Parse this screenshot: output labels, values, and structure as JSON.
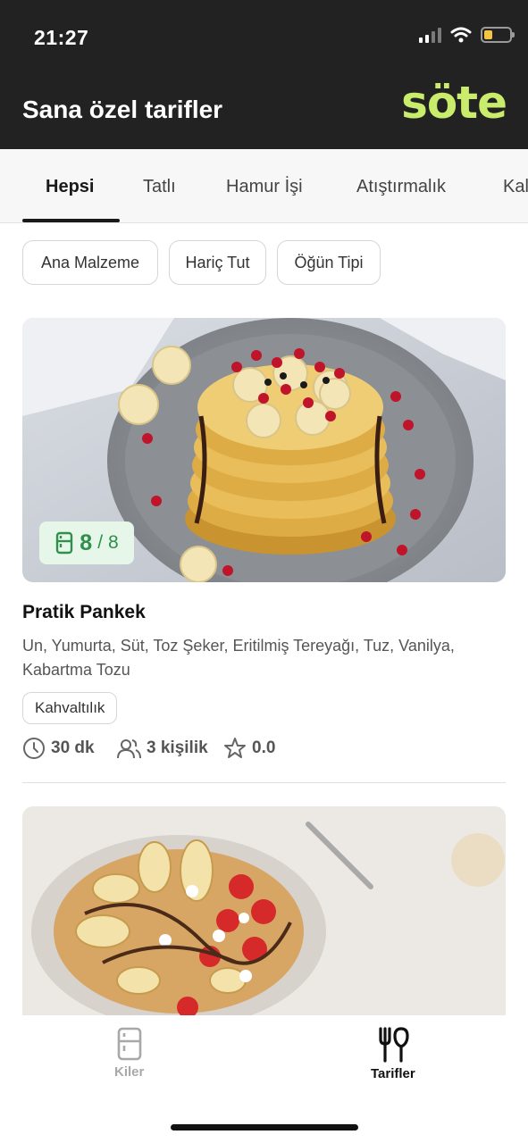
{
  "status_bar": {
    "time": "21:27",
    "icons": [
      "signal-icon",
      "wifi-icon",
      "battery-icon"
    ]
  },
  "header": {
    "title": "Sana özel tarifler",
    "logo": "söte"
  },
  "tabs": [
    {
      "label": "Hepsi",
      "active": true
    },
    {
      "label": "Tatlı",
      "active": false
    },
    {
      "label": "Hamur İşi",
      "active": false
    },
    {
      "label": "Atıştırmalık",
      "active": false
    },
    {
      "label": "Kal",
      "active": false
    }
  ],
  "filters": [
    "Ana Malzeme",
    "Hariç Tut",
    "Öğün Tipi"
  ],
  "recipes": [
    {
      "pantry_have": "8",
      "pantry_total": "8",
      "title": "Pratik Pankek",
      "ingredients": "Un, Yumurta, Süt, Toz Şeker, Eritilmiş Tereyağı, Tuz, Vanilya, Kabartma Tozu",
      "tag": "Kahvaltılık",
      "time": "30 dk",
      "servings": "3 kişilik",
      "rating": "0.0"
    }
  ],
  "bottom_nav": [
    {
      "label": "Kiler",
      "icon": "fridge-icon",
      "active": false
    },
    {
      "label": "Tarifler",
      "icon": "fork-knife-icon",
      "active": true
    }
  ],
  "colors": {
    "header_bg": "#222222",
    "logo": "#c9ec6c",
    "badge_bg": "#e6f7ea",
    "badge_text": "#2f8f4b"
  }
}
